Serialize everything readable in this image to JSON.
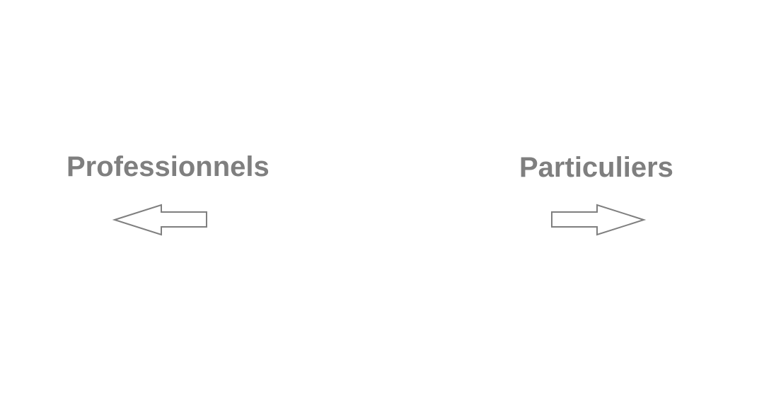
{
  "options": {
    "left": {
      "label": "Professionnels",
      "icon": "arrow-left-icon"
    },
    "right": {
      "label": "Particuliers",
      "icon": "arrow-right-icon"
    }
  },
  "colors": {
    "background": "#ffffff",
    "text": "#7f7f7f",
    "arrow_stroke": "#7f7f7f"
  }
}
